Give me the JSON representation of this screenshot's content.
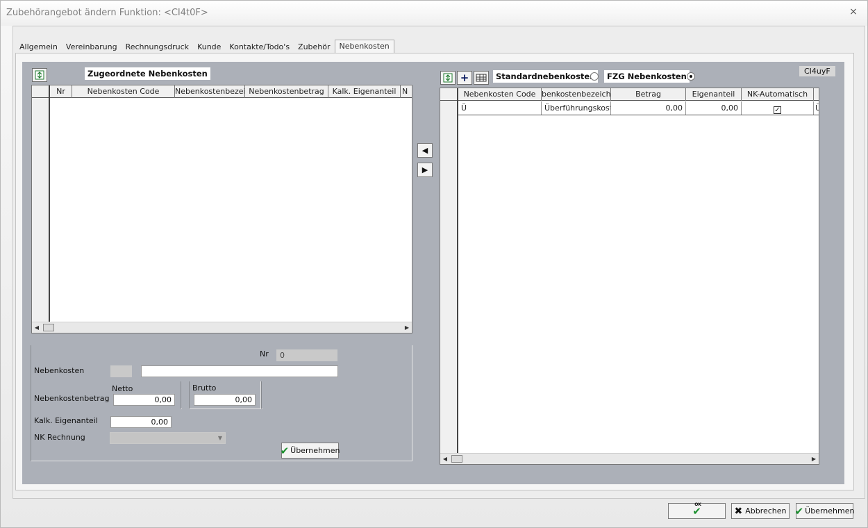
{
  "window": {
    "title": "Zubehörangebot ändern Funktion: <CI4t0F>",
    "close_glyph": "×"
  },
  "tabs": [
    {
      "label": "Allgemein",
      "active": false
    },
    {
      "label": "Vereinbarung",
      "active": false
    },
    {
      "label": "Rechnungsdruck",
      "active": false
    },
    {
      "label": "Kunde",
      "active": false
    },
    {
      "label": "Kontakte/Todo's",
      "active": false
    },
    {
      "label": "Zubehör",
      "active": false
    },
    {
      "label": "Nebenkosten",
      "active": true
    }
  ],
  "left": {
    "title": "Zugeordnete Nebenkosten",
    "refresh_icon": "refresh-icon",
    "columns": [
      "Nr",
      "Nebenkosten Code",
      "Nebenkostenbezeich",
      "Nebenkostenbetrag",
      "Kalk. Eigenanteil",
      "N"
    ],
    "rows": []
  },
  "right": {
    "code_tag": "CI4uyF",
    "standard_label": "Standardnebenkosten",
    "fzg_label": "FZG Nebenkosten",
    "standard_selected": false,
    "fzg_selected": true,
    "columns": [
      "Nebenkosten Code",
      "benkostenbezeichnu",
      "Betrag",
      "Eigenanteil",
      "NK-Automatisch",
      ""
    ],
    "rows": [
      {
        "code": "Ü",
        "bezeichnung": "Überführungskost",
        "betrag": "0,00",
        "eigenanteil": "0,00",
        "automatisch": true,
        "extra": "Ü"
      }
    ]
  },
  "form": {
    "nr_label": "Nr",
    "nr_value": "0",
    "nebenkosten_label": "Nebenkosten",
    "nebenkosten_code": "",
    "nebenkosten_text": "",
    "betrag_label": "Nebenkostenbetrag",
    "netto_label": "Netto",
    "netto_value": "0,00",
    "brutto_label": "Brutto",
    "brutto_value": "0,00",
    "eigenanteil_label": "Kalk. Eigenanteil",
    "eigenanteil_value": "0,00",
    "rechnung_label": "NK Rechnung",
    "rechnung_value": "",
    "apply_label": "Übernehmen"
  },
  "footer": {
    "ok_label": "OK",
    "cancel_label": "Abbrechen",
    "apply_label": "Übernehmen"
  },
  "colors": {
    "panel_bg": "#acb0b8",
    "ok_green": "#1a8f2e"
  }
}
